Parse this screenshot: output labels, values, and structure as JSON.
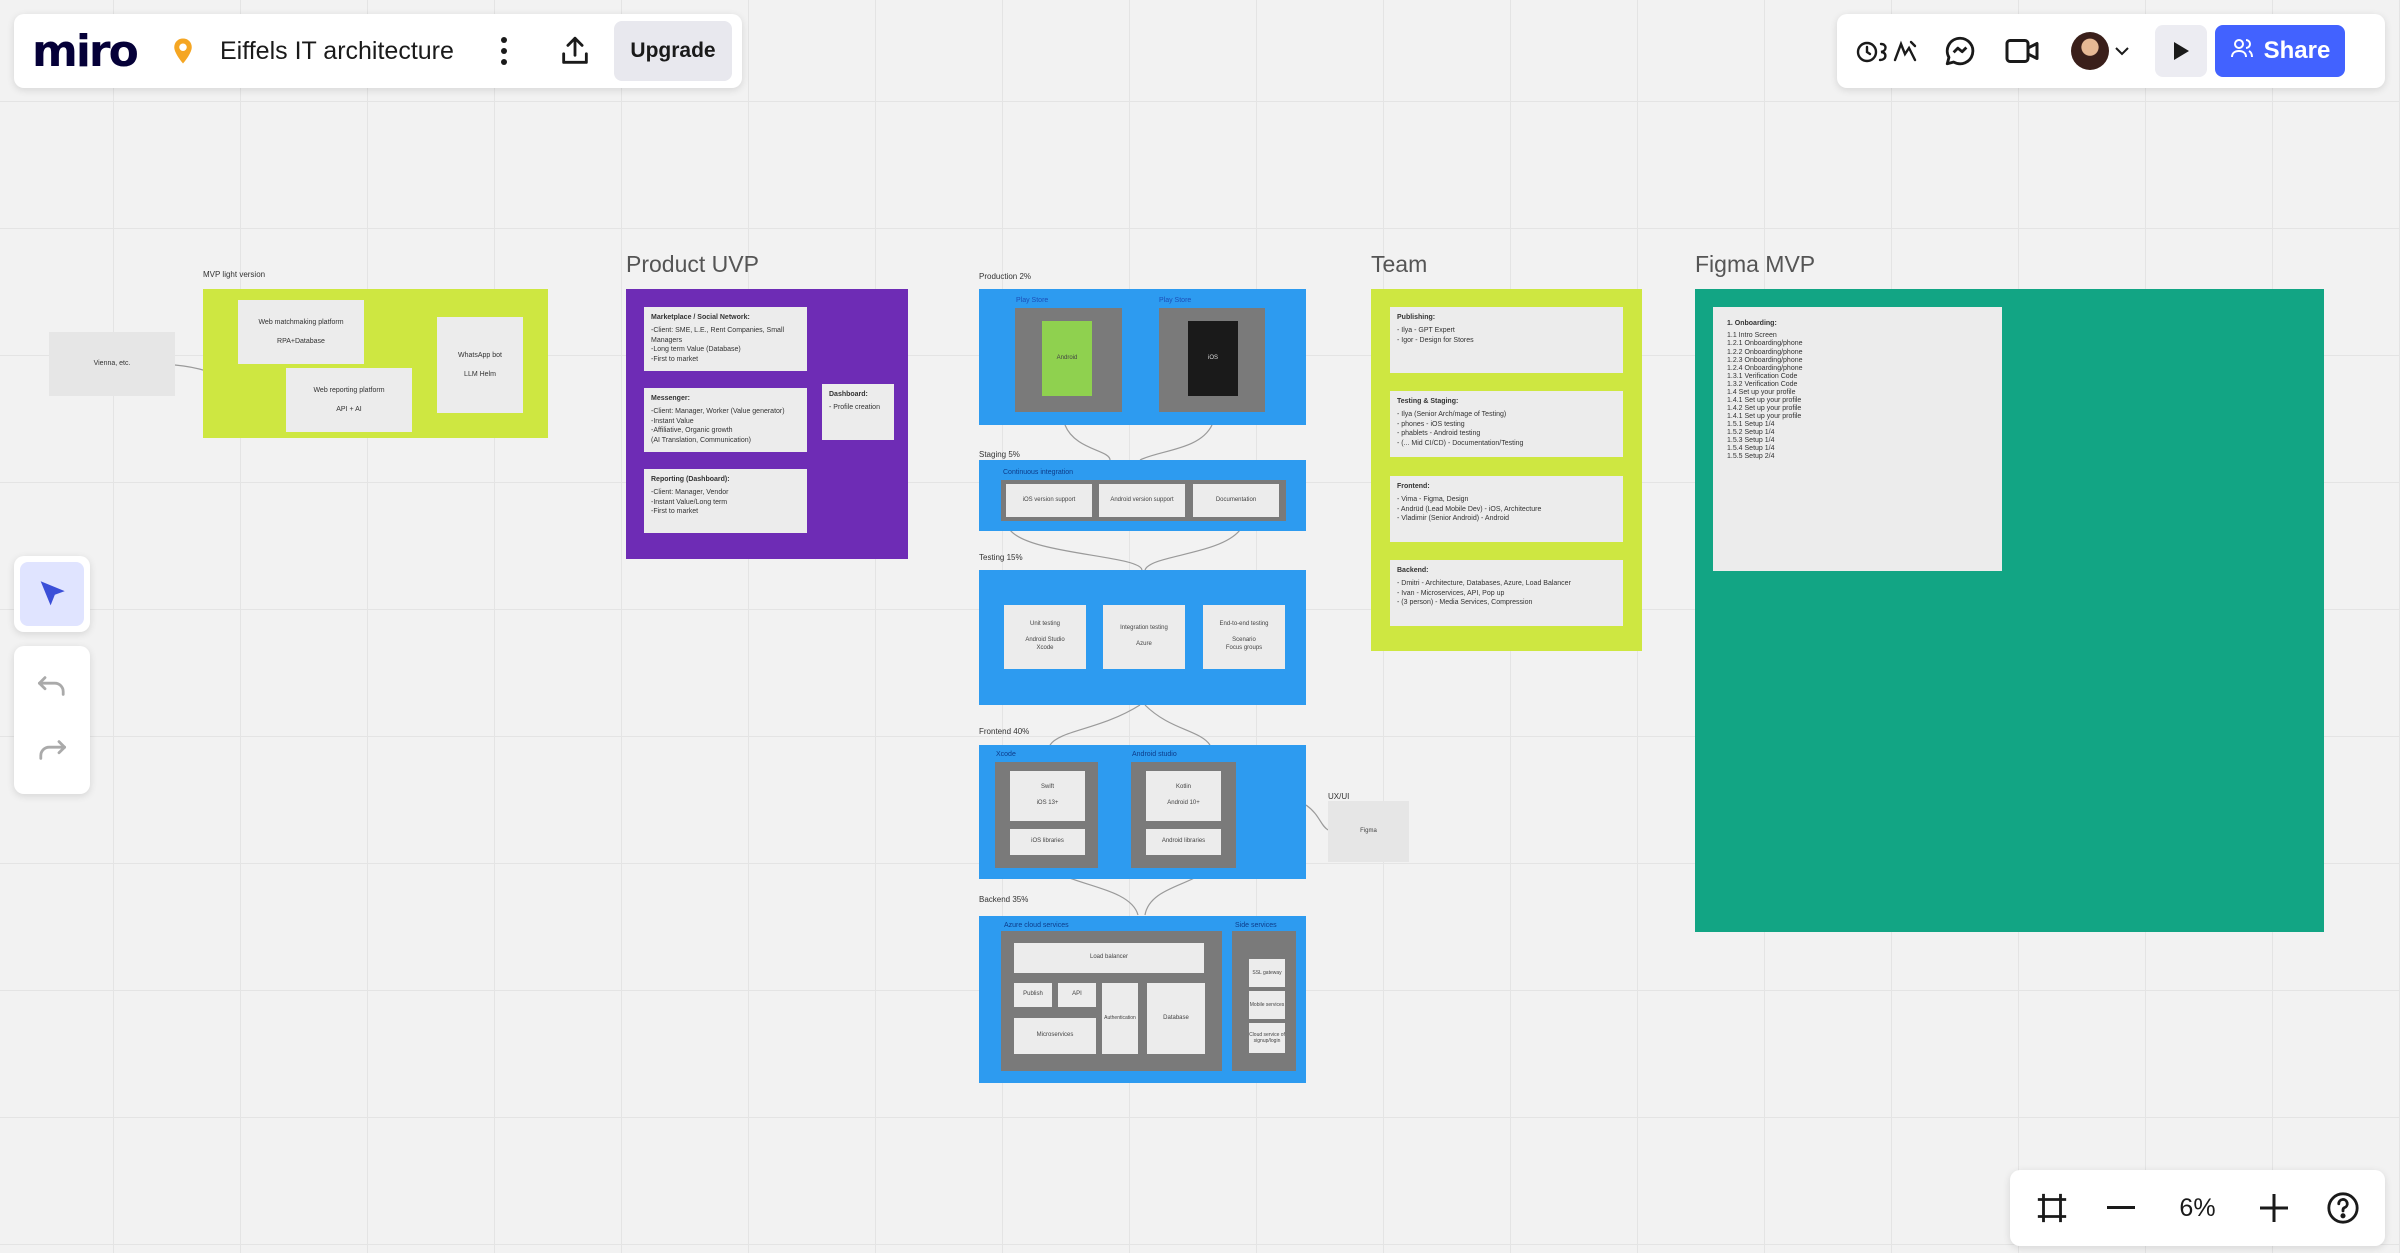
{
  "app": {
    "logo": "miro",
    "board_title": "Eiffels IT architecture",
    "upgrade_label": "Upgrade",
    "share_label": "Share",
    "zoom_level": "6%",
    "reactions_label": "․ʒ∑"
  },
  "colors": {
    "accent": "#4262ff",
    "lime": "#cee741",
    "purple": "#6e2cb5",
    "blue": "#2d9bf0",
    "teal": "#12a584",
    "gray": "#7a7a7a"
  },
  "icons": {
    "pin": "location-pin-icon",
    "more": "kebab-menu-icon",
    "export": "export-upload-icon",
    "reactions": "reactions-icon",
    "chat": "chat-bubble-icon",
    "video": "video-camera-icon",
    "chevron": "chevron-down-icon",
    "present": "play-icon",
    "share": "users-icon",
    "select": "cursor-arrow-icon",
    "undo": "undo-icon",
    "redo": "redo-icon",
    "frames": "frames-icon",
    "zoom_out": "minus-icon",
    "zoom_in": "plus-icon",
    "help": "help-circle-icon"
  },
  "board": {
    "mvp": {
      "title": "MVP light version",
      "client": "Vienna, etc.",
      "platform": "Web matchmaking platform\n\nRPA+Database",
      "whatsapp": "WhatsApp bot\n\nLLM Helm",
      "reporting": "Web reporting platform\n\nAPI + AI"
    },
    "uvp": {
      "title": "Product UVP",
      "marketplace_title": "Marketplace / Social Network:",
      "marketplace_text": "-Client: SME, L.E., Rent Companies, Small Managers\n-Long term Value (Database)\n-First to market",
      "messenger_title": "Messenger:",
      "messenger_text": "-Client: Manager, Worker (Value generator)\n-Instant Value\n-Affiliative, Organic growth\n(AI Translation, Communication)",
      "reporting_title": "Reporting (Dashboard):",
      "reporting_text": "-Client: Manager, Vendor\n-Instant Value/Long term\n-First to market",
      "dashboard_title": "Dashboard:",
      "dashboard_text": "- Profile creation"
    },
    "arch": {
      "production_label": "Production 2%",
      "play_store_1": "Play Store",
      "play_store_2": "Play Store",
      "android": "Android",
      "ios": "iOS",
      "staging_label": "Staging 5%",
      "ci_label": "Continuous integration",
      "ios_support": "iOS version support",
      "android_support": "Android version support",
      "documentation": "Documentation",
      "testing_label": "Testing 15%",
      "unit_testing": "Unit testing\n\nAndroid Studio\nXcode",
      "integration_testing": "Integration testing\n\nAzure",
      "e2e_testing": "End-to-end testing\n\nScenario\nFocus groups",
      "frontend_label": "Frontend 40%",
      "xcode_label": "Xcode",
      "android_studio_label": "Android studio",
      "swift": "Swift\n\niOS 13+",
      "kotlin": "Kotlin\n\nAndroid 10+",
      "ios_libraries": "iOS libraries",
      "android_libraries": "Android libraries",
      "uxui_label": "UX/UI",
      "figma": "Figma",
      "backend_label": "Backend 35%",
      "azure_services": "Azure cloud services",
      "side_services": "Side services",
      "load_balancer": "Load balancer",
      "publish": "Publish",
      "api": "API",
      "microservices": "Microservices",
      "authentication": "Authentication",
      "database": "Database",
      "ssl_gateway": "SSL gateway",
      "mobile_services": "Mobile services",
      "cloud_services": "Cloud service of signup/login"
    },
    "team": {
      "title": "Team",
      "publishing_title": "Publishing:",
      "publishing_text": "- Ilya - GPT Expert\n- Igor - Design for Stores",
      "testing_title": "Testing & Staging:",
      "testing_text": "- Ilya (Senior Arch/mage of Testing)\n- phones - iOS testing\n- phablets - Android testing\n- (... Mid CI/CD) - Documentation/Testing",
      "frontend_title": "Frontend:",
      "frontend_text": "- Vima - Figma, Design\n- Andrüd (Lead Mobile Dev) - iOS, Architecture\n- Vladimir (Senior Android) - Android",
      "backend_title": "Backend:",
      "backend_text": "- Dmitri - Architecture, Databases, Azure, Load Balancer\n- Ivan - Microservices, API, Pop up\n- (3 person) - Media Services, Compression"
    },
    "figma": {
      "title": "Figma MVP",
      "onboarding_title": "1. Onboarding:",
      "onboarding_text": "1.1 Intro Screen\n1.2.1 Onboarding/phone\n1.2.2 Onboarding/phone\n1.2.3 Onboarding/phone\n1.2.4 Onboarding/phone\n1.3.1 Verification Code\n1.3.2 Verification Code\n1.4 Set up your profile\n1.4.1 Set up your profile\n1.4.2 Set up your profile\n1.4.1 Set up your profile\n1.5.1 Setup 1/4\n1.5.2 Setup 1/4\n1.5.3 Setup 1/4\n1.5.4 Setup 1/4\n1.5.5 Setup 2/4"
    }
  }
}
